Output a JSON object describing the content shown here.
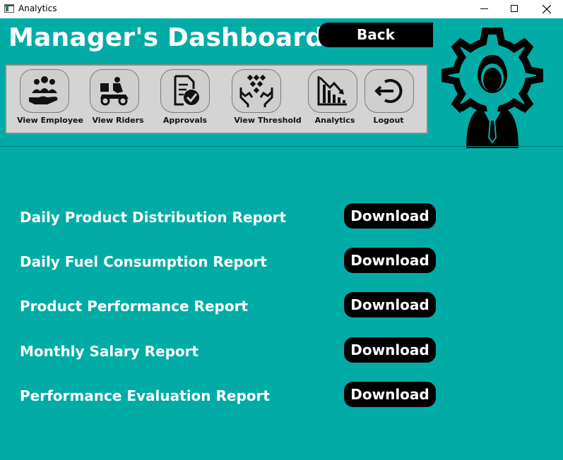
{
  "window": {
    "title": "Analytics",
    "controls": {
      "minimize_icon": "minimize-icon",
      "maximize_icon": "maximize-icon",
      "close_icon": "close-icon"
    }
  },
  "header": {
    "title": "Manager's Dashboard",
    "back_label": "Back",
    "avatar_icon": "manager-gear-avatar-icon"
  },
  "toolbar": {
    "items": [
      {
        "label": "View Employee",
        "icon": "employees-hand-icon"
      },
      {
        "label": "View Riders",
        "icon": "delivery-rider-icon"
      },
      {
        "label": "Approvals",
        "icon": "approval-document-icon"
      },
      {
        "label": "View Threshold",
        "icon": "threshold-hands-icon"
      },
      {
        "label": "Analytics",
        "icon": "analytics-chart-icon"
      },
      {
        "label": "Logout",
        "icon": "logout-icon"
      }
    ]
  },
  "reports": [
    {
      "label": "Daily Product Distribution Report",
      "button": "Download"
    },
    {
      "label": "Daily Fuel Consumption Report",
      "button": "Download"
    },
    {
      "label": "Product Performance Report",
      "button": "Download"
    },
    {
      "label": "Monthly Salary Report",
      "button": "Download"
    },
    {
      "label": "Performance Evaluation Report",
      "button": "Download"
    }
  ],
  "colors": {
    "background": "#02aca6",
    "toolbar_bg": "#d4d4d4",
    "button_bg": "#000000",
    "text": "#ffffff"
  }
}
